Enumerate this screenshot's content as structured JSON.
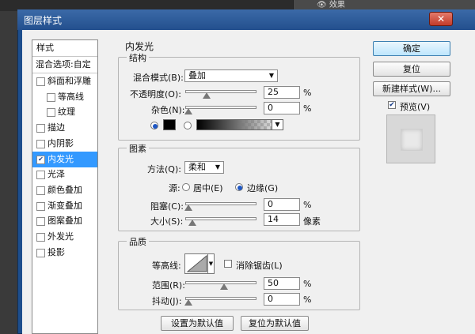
{
  "background": {
    "layer_effect_label": "效果"
  },
  "window": {
    "title": "图层样式",
    "close_glyph": "✕"
  },
  "style_list": {
    "header": "样式",
    "blend_options": "混合选项:自定",
    "items": [
      {
        "label": "斜面和浮雕",
        "checked": false,
        "indent": false
      },
      {
        "label": "等高线",
        "checked": false,
        "indent": true
      },
      {
        "label": "纹理",
        "checked": false,
        "indent": true
      },
      {
        "label": "描边",
        "checked": false,
        "indent": false
      },
      {
        "label": "内阴影",
        "checked": false,
        "indent": false
      },
      {
        "label": "内发光",
        "checked": true,
        "indent": false,
        "selected": true
      },
      {
        "label": "光泽",
        "checked": false,
        "indent": false
      },
      {
        "label": "颜色叠加",
        "checked": false,
        "indent": false
      },
      {
        "label": "渐变叠加",
        "checked": false,
        "indent": false
      },
      {
        "label": "图案叠加",
        "checked": false,
        "indent": false
      },
      {
        "label": "外发光",
        "checked": false,
        "indent": false
      },
      {
        "label": "投影",
        "checked": false,
        "indent": false
      }
    ]
  },
  "panel": {
    "title": "内发光",
    "structure": {
      "legend": "结构",
      "blend_mode_label": "混合模式(B):",
      "blend_mode_value": "叠加",
      "opacity_label": "不透明度(O):",
      "opacity_value": "25",
      "opacity_pct": 25,
      "noise_label": "杂色(N):",
      "noise_value": "0",
      "noise_pct": 0,
      "percent": "%",
      "color": "#000000"
    },
    "elements": {
      "legend": "图素",
      "method_label": "方法(Q):",
      "method_value": "柔和",
      "source_label": "源:",
      "source_center": "居中(E)",
      "source_edge": "边缘(G)",
      "choke_label": "阻塞(C):",
      "choke_value": "0",
      "choke_pct": 0,
      "size_label": "大小(S):",
      "size_value": "14",
      "size_unit": "像素",
      "size_pct": 5.6
    },
    "quality": {
      "legend": "品质",
      "contour_label": "等高线:",
      "antialias_label": "消除锯齿(L)",
      "range_label": "范围(R):",
      "range_value": "50",
      "range_pct": 50,
      "jitter_label": "抖动(J):",
      "jitter_value": "0",
      "jitter_pct": 0
    },
    "set_default": "设置为默认值",
    "reset_default": "复位为默认值"
  },
  "buttons": {
    "ok": "确定",
    "reset": "复位",
    "new_style": "新建样式(W)...",
    "preview_label": "预览(V)",
    "preview_checked": true
  },
  "colors": {
    "selection": "#3399ff",
    "title_bar": "#234f8e"
  }
}
